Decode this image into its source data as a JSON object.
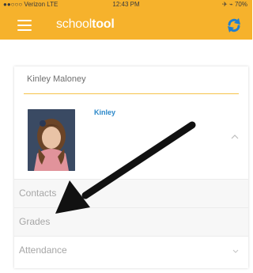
{
  "status_bar": {
    "carrier": "●●○○○ Verizon LTE",
    "time": "12:43 PM",
    "battery": "✈ ⌁ 70%"
  },
  "app_bar": {
    "brand_part1": "school",
    "brand_part2": "tool",
    "menu_icon": "hamburger-menu-icon",
    "refresh_icon": "refresh-icon",
    "accent_color": "#f6b22c"
  },
  "student": {
    "full_name": "Kinley Maloney",
    "first_name": "Kinley",
    "name_color": "#2a87c9"
  },
  "sections": [
    {
      "label": "Contacts"
    },
    {
      "label": "Grades"
    },
    {
      "label": "Attendance"
    }
  ]
}
